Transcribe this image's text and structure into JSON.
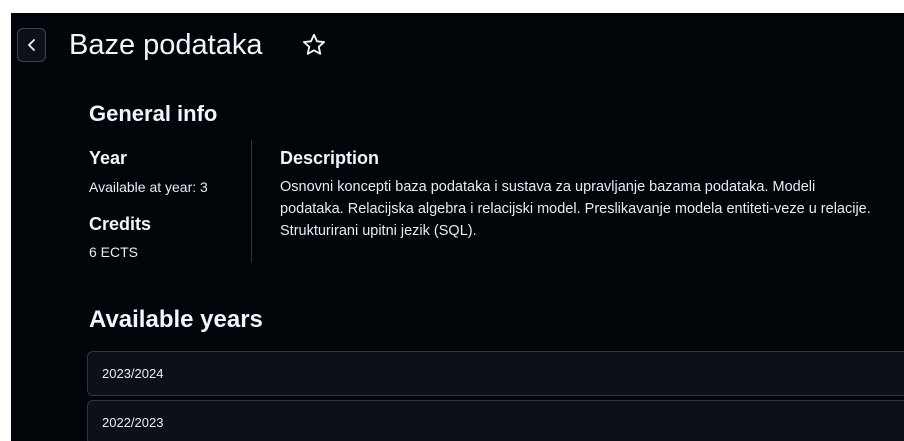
{
  "header": {
    "title": "Baze podataka",
    "back_icon": "chevron-left-icon",
    "favorite_icon": "star-outline-icon"
  },
  "general_info": {
    "title": "General info",
    "year_label": "Year",
    "year_value": "Available at year: 3",
    "credits_label": "Credits",
    "credits_value": "6 ECTS",
    "description_label": "Description",
    "description_text": "Osnovni koncepti baza podataka i sustava za upravljanje bazama podataka. Modeli podataka. Relacijska algebra i relacijski model. Preslikavanje modela entiteti-veze u relacije. Strukturirani upitni jezik (SQL)."
  },
  "available_years": {
    "title": "Available years",
    "items": [
      {
        "label": "2023/2024"
      },
      {
        "label": "2022/2023"
      }
    ]
  },
  "colors": {
    "background": "#010409",
    "panel": "#0d1117",
    "border": "#30363d",
    "text": "#f0f6fc"
  }
}
